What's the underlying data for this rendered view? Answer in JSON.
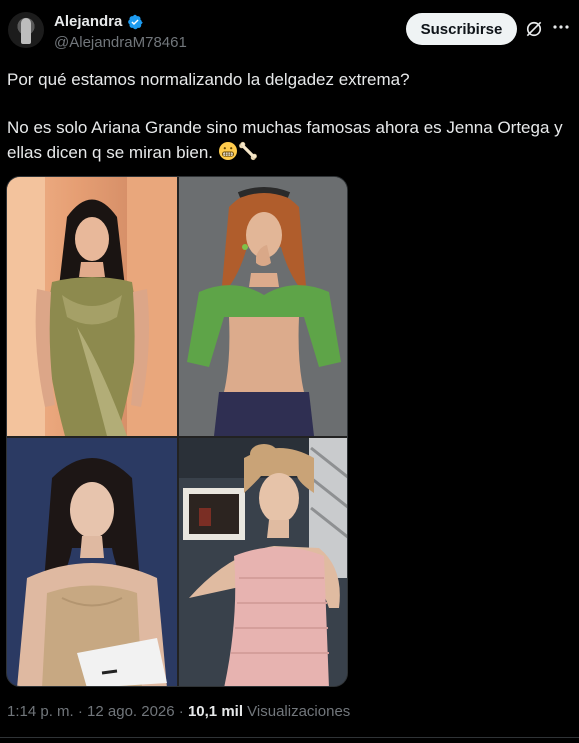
{
  "post": {
    "author_name": "Alejandra",
    "author_handle": "@AlejandraM78461",
    "subscribe_label": "Suscribirse",
    "text_line1": "Por qué estamos normalizando la delgadez extrema?",
    "text_line2": "No es solo Ariana Grande sino muchas famosas ahora es Jenna Ortega y ellas dicen q se miran bien.",
    "emojis": [
      "grimacing-face",
      "bone"
    ],
    "timestamp": "1:14 p. m. · 12 ago. 2026 · ",
    "views_count": "10,1 mil",
    "views_label": " Visualizaciones"
  },
  "icons": {
    "verified": "verified-badge-icon",
    "grok": "grok-icon",
    "more": "more-options-icon"
  },
  "colors": {
    "background": "#000000",
    "text": "#e7e9ea",
    "secondary_text": "#71767b",
    "verified_blue": "#1d9bf0",
    "subscribe_bg": "#eff3f4"
  }
}
